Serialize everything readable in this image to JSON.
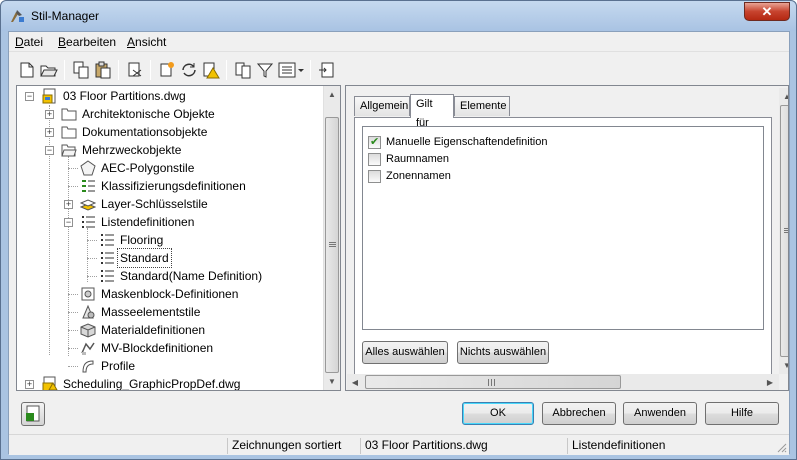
{
  "window": {
    "title": "Stil-Manager",
    "close_label": "✕"
  },
  "menu": [
    {
      "label": "Datei",
      "mnemonic": "D",
      "rest": "atei"
    },
    {
      "label": "Bearbeiten",
      "mnemonic": "B",
      "rest": "earbeiten"
    },
    {
      "label": "Ansicht",
      "mnemonic": "A",
      "rest": "nsicht"
    }
  ],
  "toolbar": {
    "icons": [
      "new-icon",
      "open-icon",
      "copy-icon",
      "paste-icon",
      "purge-icon",
      "new-style-icon",
      "synchronize-icon",
      "warning-icon",
      "list-view-icon",
      "filter-icon",
      "view-toggle-icon",
      "switch-drawing-icon"
    ]
  },
  "tree": {
    "root": "03 Floor Partitions.dwg",
    "items": {
      "architektonische": "Architektonische Objekte",
      "dokumentation": "Dokumentationsobjekte",
      "mehrzweck": "Mehrzweckobjekte",
      "aec_polygon": "AEC-Polygonstile",
      "klassifizierung": "Klassifizierungsdefinitionen",
      "layer_schluessel": "Layer-Schlüsselstile",
      "listendefinitionen": "Listendefinitionen",
      "flooring": "Flooring",
      "standard": "Standard",
      "standard_name": "Standard(Name Definition)",
      "maskenblock": "Maskenblock-Definitionen",
      "masseelement": "Masseelementstile",
      "material": "Materialdefinitionen",
      "mv_block": "MV-Blockdefinitionen",
      "profile": "Profile"
    },
    "second_root": "Scheduling_GraphicPropDef.dwg"
  },
  "tabs": {
    "allgemein": "Allgemein",
    "gilt_fuer": "Gilt für",
    "elemente": "Elemente"
  },
  "applies_to": [
    {
      "label": "Manuelle Eigenschaftendefinition",
      "checked": true
    },
    {
      "label": "Raumnamen",
      "checked": false
    },
    {
      "label": "Zonennamen",
      "checked": false
    }
  ],
  "buttons": {
    "select_all": "Alles auswählen",
    "select_none": "Nichts auswählen",
    "ok": "OK",
    "cancel": "Abbrechen",
    "apply": "Anwenden",
    "help": "Hilfe"
  },
  "status": {
    "sort": "Zeichnungen sortiert",
    "drawing": "03 Floor Partitions.dwg",
    "selection": "Listendefinitionen"
  },
  "colors": {
    "title_bg": "#aac4e2",
    "close_red": "#c7432e",
    "check_green": "#2a8a1c"
  }
}
